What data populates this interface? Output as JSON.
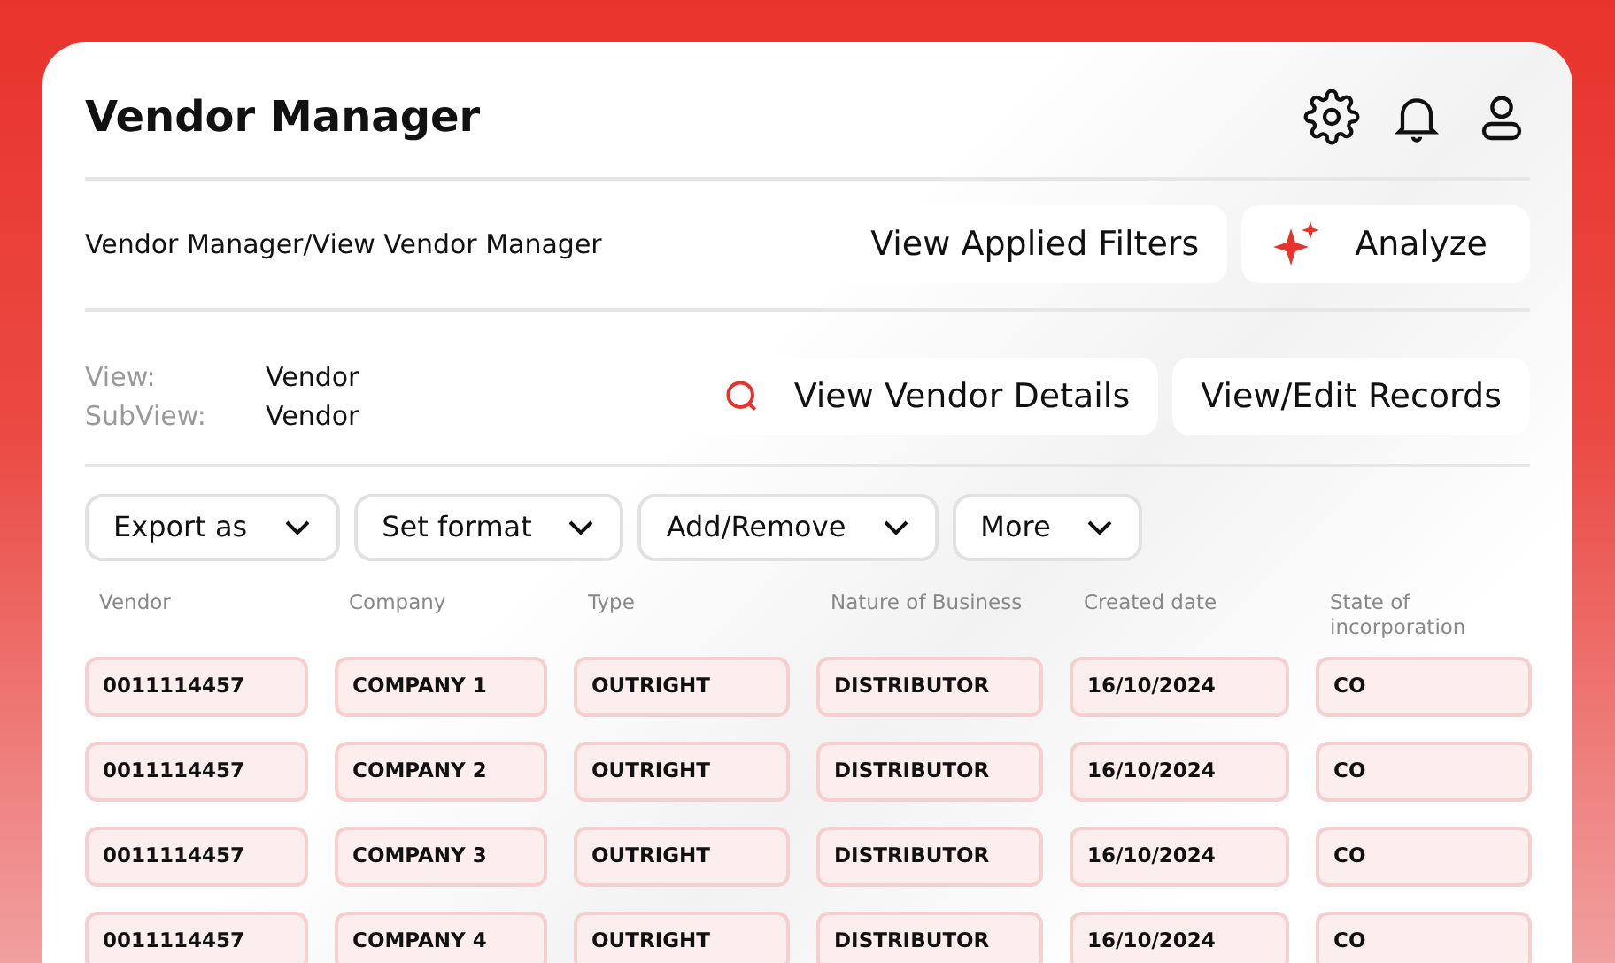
{
  "header": {
    "title": "Vendor Manager"
  },
  "breadcrumb": "Vendor Manager/View Vendor Manager",
  "top_actions": [
    {
      "label": "View Applied Filters",
      "kind": "plain"
    },
    {
      "label": "Analyze",
      "kind": "sparkle"
    }
  ],
  "view_info": [
    {
      "label": "View:",
      "value": "Vendor"
    },
    {
      "label": "SubView:",
      "value": "Vendor"
    }
  ],
  "view_actions": [
    {
      "label": "View Vendor Details",
      "kind": "search"
    },
    {
      "label": "View/Edit Records",
      "kind": "plain"
    }
  ],
  "dropdowns": [
    "Export as",
    "Set format",
    "Add/Remove",
    "More"
  ],
  "table": {
    "columns": [
      "Vendor",
      "Company",
      "Type",
      "Nature of Business",
      "Created date",
      "State of incorporation"
    ],
    "rows": [
      [
        "0011114457",
        "COMPANY 1",
        "OUTRIGHT",
        "DISTRIBUTOR",
        "16/10/2024",
        "CO"
      ],
      [
        "0011114457",
        "COMPANY 2",
        "OUTRIGHT",
        "DISTRIBUTOR",
        "16/10/2024",
        "CO"
      ],
      [
        "0011114457",
        "COMPANY 3",
        "OUTRIGHT",
        "DISTRIBUTOR",
        "16/10/2024",
        "CO"
      ],
      [
        "0011114457",
        "COMPANY 4",
        "OUTRIGHT",
        "DISTRIBUTOR",
        "16/10/2024",
        "CO"
      ]
    ]
  }
}
